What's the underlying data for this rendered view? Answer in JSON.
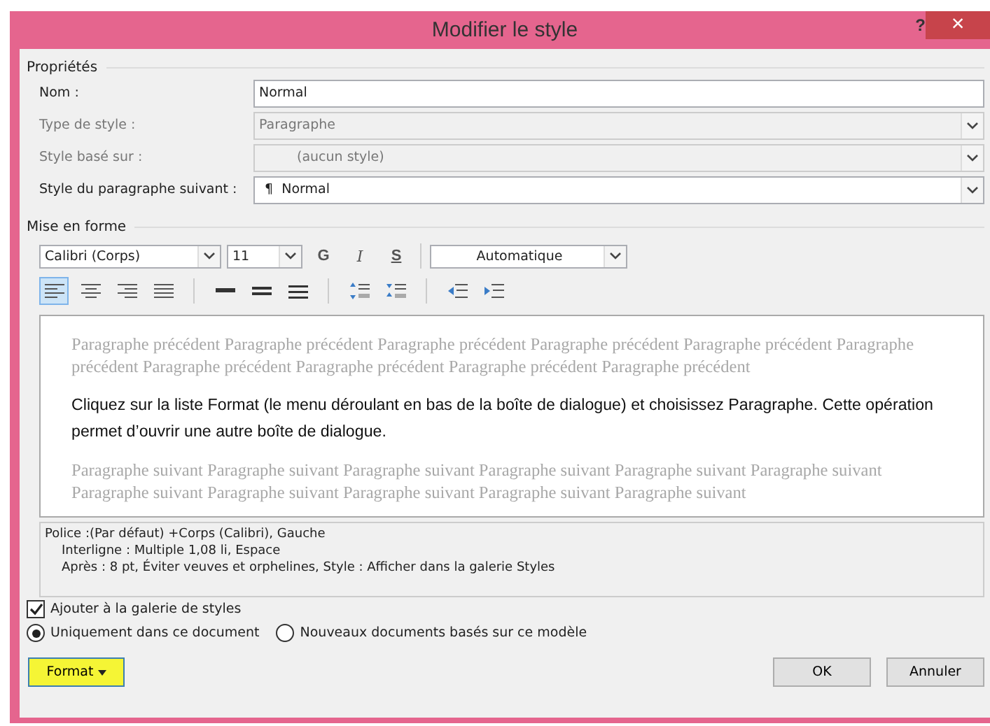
{
  "window": {
    "title": "Modifier le style",
    "help": "?",
    "close": "×"
  },
  "properties": {
    "heading": "Propriétés",
    "fields": [
      {
        "label": "Nom :",
        "value": "Normal",
        "kind": "text",
        "disabled": false
      },
      {
        "label": "Type de style :",
        "value": "Paragraphe",
        "kind": "combo",
        "disabled": true
      },
      {
        "label": "Style basé sur :",
        "value": "(aucun style)",
        "kind": "combo",
        "disabled": true
      },
      {
        "label": "Style du paragraphe suivant :",
        "value": "¶  Normal",
        "kind": "combo",
        "disabled": false
      }
    ]
  },
  "formatting": {
    "heading": "Mise en forme",
    "font": "Calibri (Corps)",
    "size": "11",
    "bold": "G",
    "italic": "I",
    "underline": "S",
    "font_color_label": "Automatique",
    "paragraph_buttons": [
      {
        "kind": "align-left",
        "selected": true
      },
      {
        "kind": "align-center",
        "selected": false
      },
      {
        "kind": "align-right",
        "selected": false
      },
      {
        "kind": "justify",
        "selected": false
      },
      {
        "kind": "single-spacing",
        "selected": false
      },
      {
        "kind": "one-half-spacing",
        "selected": false
      },
      {
        "kind": "double-spacing",
        "selected": false
      },
      {
        "kind": "space-before",
        "selected": false
      },
      {
        "kind": "space-after",
        "selected": false
      },
      {
        "kind": "outdent",
        "selected": false
      },
      {
        "kind": "indent",
        "selected": false
      }
    ]
  },
  "preview": {
    "previous": "Paragraphe précédent Paragraphe précédent Paragraphe précédent Paragraphe précédent Paragraphe précédent Paragraphe précédent Paragraphe précédent Paragraphe précédent Paragraphe précédent Paragraphe précédent",
    "current": "Cliquez sur la liste Format (le menu déroulant en bas de la boîte de dialogue) et choisissez Paragraphe. Cette opération permet d’ouvrir une autre boîte de dialogue.",
    "next": "Paragraphe suivant Paragraphe suivant Paragraphe suivant Paragraphe suivant Paragraphe suivant Paragraphe suivant Paragraphe suivant Paragraphe suivant Paragraphe suivant Paragraphe suivant Paragraphe suivant"
  },
  "description": [
    "Police :(Par défaut) +Corps (Calibri), Gauche",
    "Interligne : Multiple 1,08 li, Espace",
    "Après : 8 pt, Éviter veuves et orphelines, Style : Afficher dans la galerie Styles"
  ],
  "add_to_gallery": {
    "label": "Ajouter à la galerie de styles",
    "checked": true
  },
  "scope": [
    {
      "label": "Uniquement dans ce document",
      "selected": true
    },
    {
      "label": "Nouveaux documents basés sur ce modèle",
      "selected": false
    }
  ],
  "buttons": {
    "format": "Format",
    "ok": "OK",
    "cancel": "Annuler"
  }
}
